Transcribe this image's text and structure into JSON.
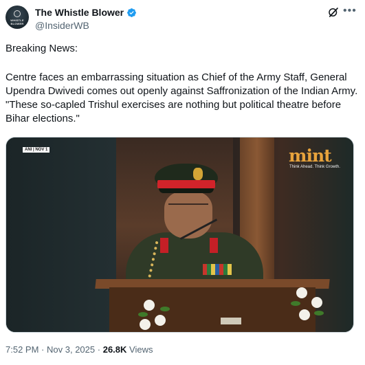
{
  "author": {
    "display_name": "The Whistle Blower",
    "handle": "@InsiderWB",
    "avatar_text": "WHISTLE BLOWER",
    "verified": true,
    "verified_color": "#1d9bf0"
  },
  "tweet": {
    "line1": "Breaking News:",
    "body": "Centre faces an embarrassing situation as Chief of the Army Staff, General Upendra Dwivedi comes out openly against Saffronization of the Indian Army. \"These so-capled Trishul exercises are nothing but political theatre before Bihar elections.\""
  },
  "media": {
    "source_tag": "ANI | NOV 1",
    "brand_logo": "mint",
    "brand_tagline": "Think Ahead. Think Growth.",
    "brand_color": "#e8a33c"
  },
  "footer": {
    "time": "7:52 PM",
    "separator": "·",
    "date": "Nov 3, 2025",
    "views_count": "26.8K",
    "views_label": "Views"
  },
  "icons": {
    "grok": "grok-icon",
    "more": "more-icon",
    "verified": "verified-badge-icon"
  }
}
